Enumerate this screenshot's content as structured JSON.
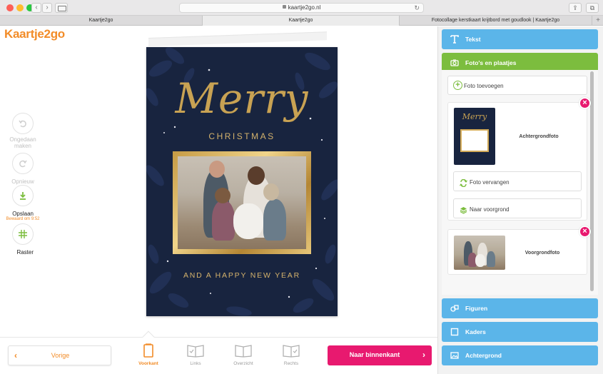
{
  "browser": {
    "url": "kaartje2go.nl",
    "tabs": [
      "Kaartje2go",
      "Kaartje2go",
      "Fotocollage kerstkaart krijtbord met goudlook | Kaartje2go"
    ],
    "new_tab_symbol": "+"
  },
  "app": {
    "logo": "Kaartje2go",
    "brand_color": "#f28c28",
    "accent_pink": "#e8196f",
    "accent_blue": "#5bb5e9",
    "accent_green": "#7cbd3e"
  },
  "left_tools": [
    {
      "label": "Ongedaan maken",
      "icon": "undo-icon",
      "enabled": false
    },
    {
      "label": "Opnieuw",
      "icon": "redo-icon",
      "enabled": false
    },
    {
      "label": "Opslaan",
      "icon": "download-icon",
      "enabled": true,
      "note": "Bewaard om 9:52"
    },
    {
      "label": "Raster",
      "icon": "grid-icon",
      "enabled": true
    }
  ],
  "card": {
    "title": "Merry",
    "subtitle": "CHRISTMAS",
    "footer": "AND A HAPPY NEW YEAR"
  },
  "bottom_bar": {
    "prev_label": "Vorige",
    "next_label": "Naar binnenkant",
    "views": [
      {
        "label": "Voorkant",
        "active": true
      },
      {
        "label": "Links",
        "active": false
      },
      {
        "label": "Overzicht",
        "active": false
      },
      {
        "label": "Rechts",
        "active": false
      }
    ]
  },
  "right_panel": {
    "sections": {
      "text": "Tekst",
      "photos": "Foto's en plaatjes",
      "shapes": "Figuren",
      "frames": "Kaders",
      "background": "Achtergrond"
    },
    "add_photo_label": "Foto toevoegen",
    "background_photo_label": "Achtergrondfoto",
    "replace_photo_label": "Foto vervangen",
    "to_front_label": "Naar voorgrond",
    "foreground_photo_label": "Voorgrondfoto",
    "thumb_title": "Merry"
  }
}
